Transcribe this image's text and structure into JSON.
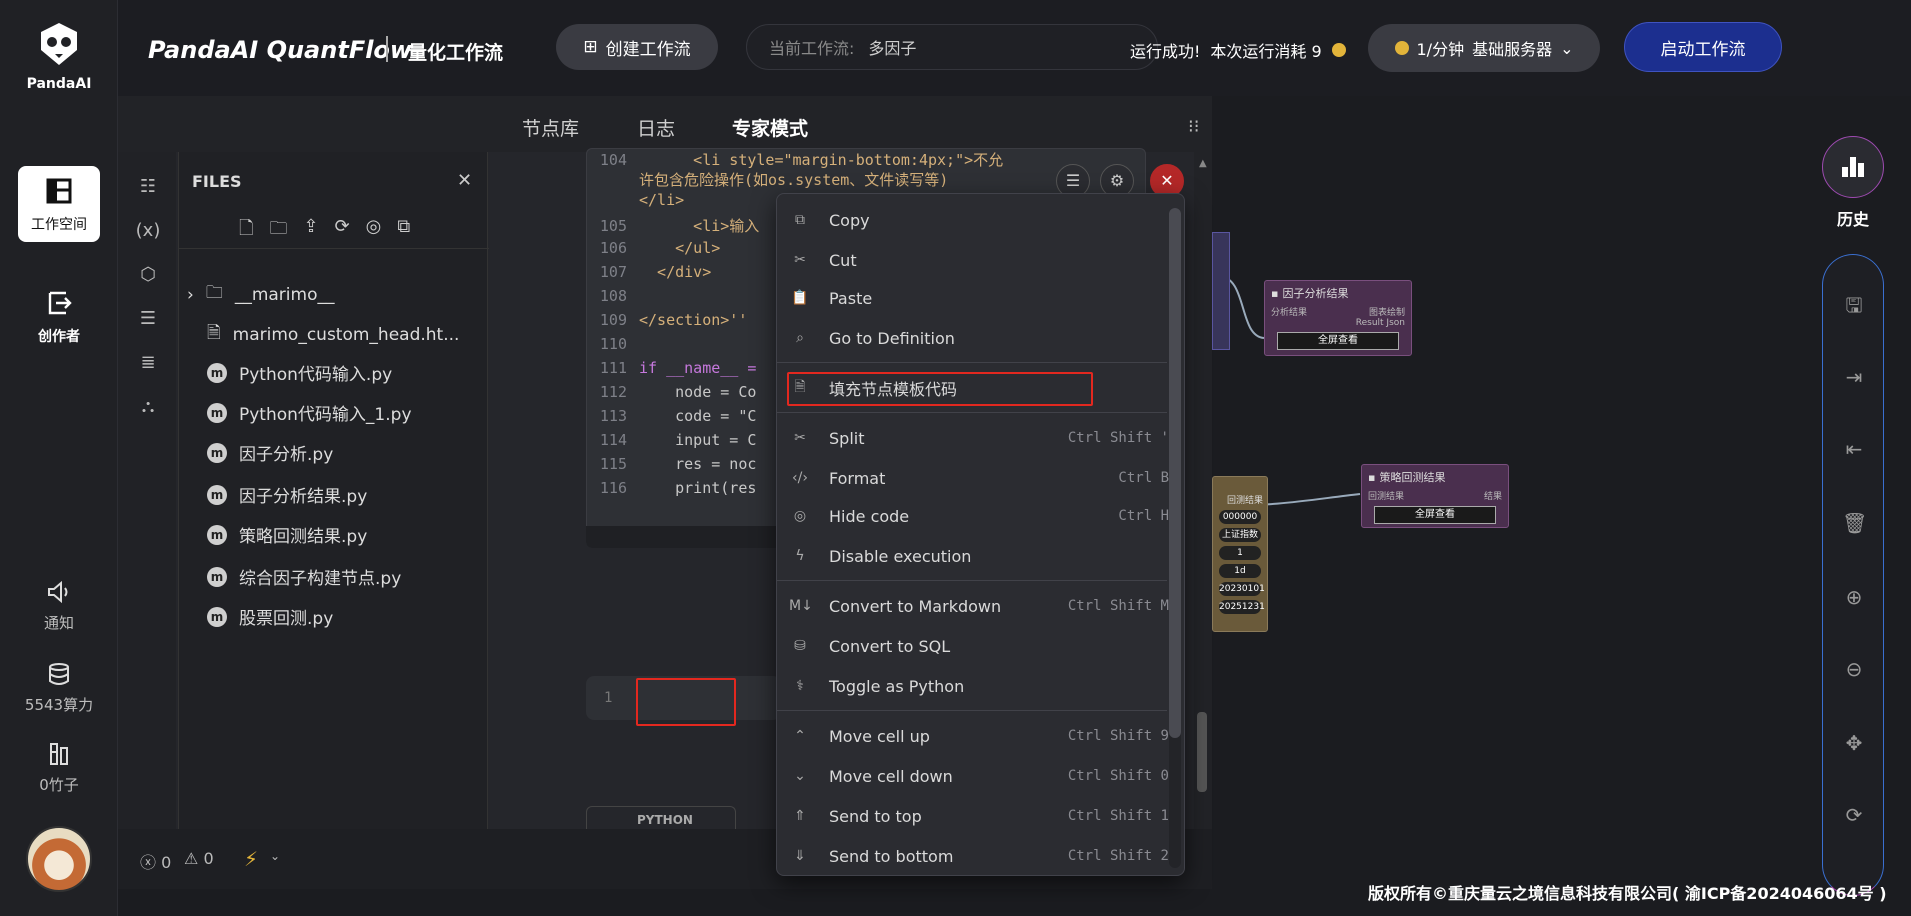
{
  "app": {
    "logo_text": "PandaAI",
    "brand": "PandaAI QuantFlow",
    "brand_sub": "量化工作流"
  },
  "sidebar": {
    "workspace_label": "工作空间",
    "creator_label": "创作者",
    "notify_label": "通知",
    "compute_label": "5543算力",
    "bamboo_label": "0竹子"
  },
  "header": {
    "create_label": "创建工作流",
    "current_flow_key": "当前工作流:",
    "current_flow_value": "多因子",
    "run_status": "运行成功!",
    "run_cost": "本次运行消耗 9",
    "server_rate": "1/分钟",
    "server_name": "基础服务器",
    "start_label": "启动工作流"
  },
  "tabs": [
    "节点库",
    "日志",
    "专家模式"
  ],
  "files": {
    "title": "FILES",
    "items": [
      {
        "name": "__marimo__",
        "type": "folder"
      },
      {
        "name": "marimo_custom_head.ht...",
        "type": "html"
      },
      {
        "name": "Python代码输入.py",
        "type": "py"
      },
      {
        "name": "Python代码输入_1.py",
        "type": "py"
      },
      {
        "name": "因子分析.py",
        "type": "py"
      },
      {
        "name": "因子分析结果.py",
        "type": "py"
      },
      {
        "name": "策略回测结果.py",
        "type": "py"
      },
      {
        "name": "综合因子构建节点.py",
        "type": "py"
      },
      {
        "name": "股票回测.py",
        "type": "py"
      }
    ]
  },
  "code_lines": [
    {
      "n": "104",
      "t": "      <li style=\"margin-bottom:4px;\">不允"
    },
    {
      "n": "",
      "t": "许包含危险操作(如os.system、文件读写等)"
    },
    {
      "n": "",
      "t": "</li>"
    },
    {
      "n": "105",
      "t": "      <li>输入"
    },
    {
      "n": "106",
      "t": "    </ul>"
    },
    {
      "n": "107",
      "t": "  </div>"
    },
    {
      "n": "108",
      "t": ""
    },
    {
      "n": "109",
      "t": "</section>''"
    },
    {
      "n": "110",
      "t": ""
    },
    {
      "n": "111",
      "t": "if __name__ ="
    },
    {
      "n": "112",
      "t": "    node = Co"
    },
    {
      "n": "113",
      "t": "    code = \"C"
    },
    {
      "n": "114",
      "t": "    input = C"
    },
    {
      "n": "115",
      "t": "    res = noc"
    },
    {
      "n": "116",
      "t": "    print(res"
    }
  ],
  "cell_number": "1",
  "python_tab": "PYTHON",
  "status": {
    "errors": "0",
    "warnings": "0"
  },
  "context_menu": {
    "items": [
      {
        "label": "Copy",
        "shortcut": "",
        "icon": "copy-icon"
      },
      {
        "label": "Cut",
        "shortcut": "",
        "icon": "scissors-icon"
      },
      {
        "label": "Paste",
        "shortcut": "",
        "icon": "paste-icon"
      },
      {
        "label": "Go to Definition",
        "shortcut": "",
        "icon": "search-icon"
      },
      {
        "label": "填充节点模板代码",
        "shortcut": "",
        "icon": "file-icon"
      },
      {
        "label": "Split",
        "shortcut": "Ctrl Shift '",
        "icon": "scissors-icon"
      },
      {
        "label": "Format",
        "shortcut": "Ctrl B",
        "icon": "code-icon"
      },
      {
        "label": "Hide code",
        "shortcut": "Ctrl H",
        "icon": "eye-off-icon"
      },
      {
        "label": "Disable execution",
        "shortcut": "",
        "icon": "bolt-icon"
      },
      {
        "label": "Convert to Markdown",
        "shortcut": "Ctrl Shift M",
        "icon": "markdown-icon"
      },
      {
        "label": "Convert to SQL",
        "shortcut": "",
        "icon": "database-icon"
      },
      {
        "label": "Toggle as Python",
        "shortcut": "",
        "icon": "python-icon"
      },
      {
        "label": "Move cell up",
        "shortcut": "Ctrl Shift 9",
        "icon": "chevron-up-icon"
      },
      {
        "label": "Move cell down",
        "shortcut": "Ctrl Shift 0",
        "icon": "chevron-down-icon"
      },
      {
        "label": "Send to top",
        "shortcut": "Ctrl Shift 1",
        "icon": "double-chevron-up-icon"
      },
      {
        "label": "Send to bottom",
        "shortcut": "Ctrl Shift 2",
        "icon": "double-chevron-down-icon"
      }
    ]
  },
  "nodes": {
    "factor_result": {
      "title": "因子分析结果",
      "in_port": "分析结果",
      "out1": "图表绘制",
      "out2": "Result Json",
      "button": "全屏查看"
    },
    "backtest_result": {
      "title": "策略回测结果",
      "in_port": "回测结果",
      "out1": "结果",
      "button": "全屏查看"
    },
    "partial": {
      "label": "回测结果",
      "rows": [
        "000000",
        "上证指数",
        "1",
        "1d",
        "20230101",
        "20251231"
      ]
    }
  },
  "history_label": "历史",
  "copyright": "版权所有©重庆量云之境信息科技有限公司( 渝ICP备2024046064号 )"
}
